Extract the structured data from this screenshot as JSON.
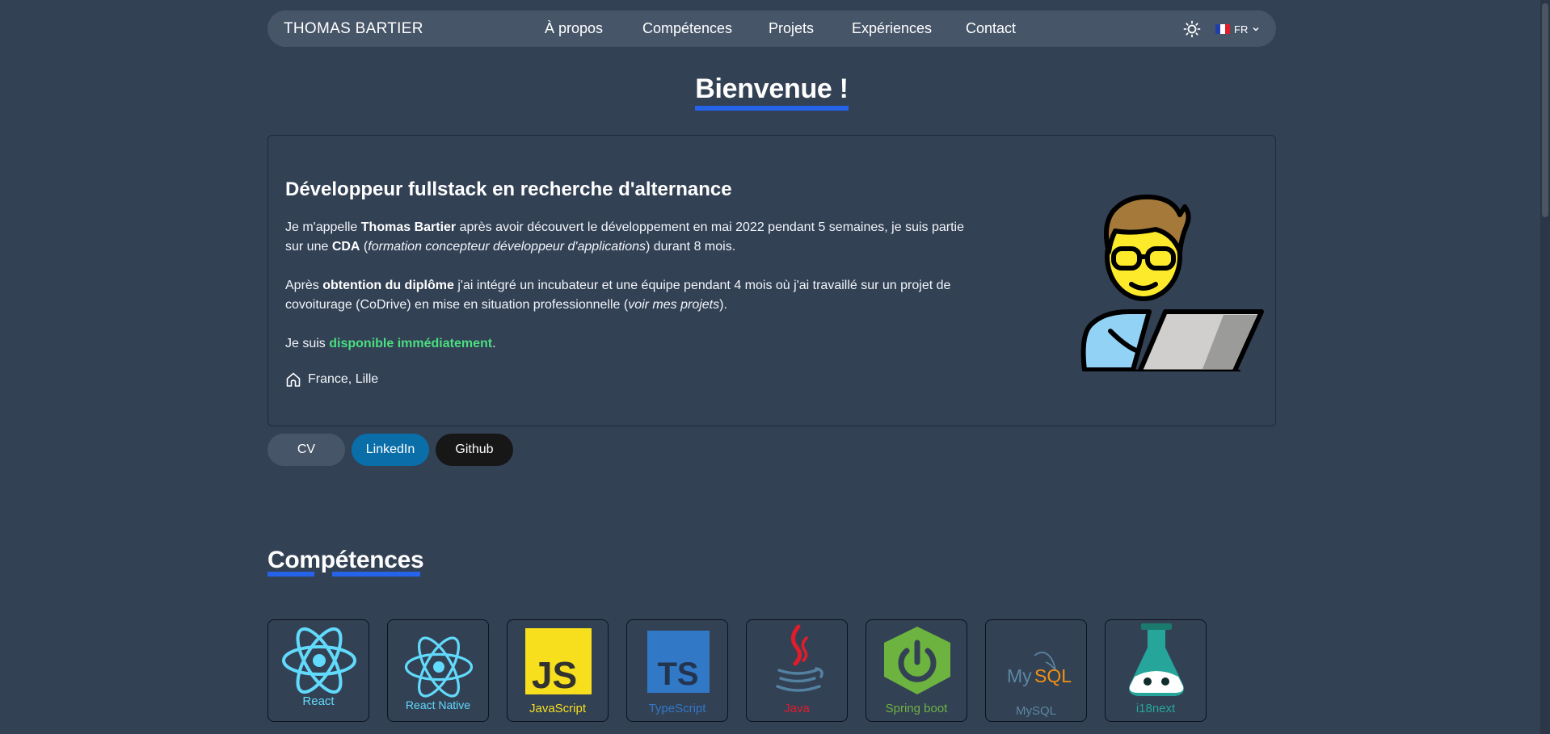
{
  "navbar": {
    "brand": "THOMAS BARTIER",
    "links": [
      {
        "label": "À propos"
      },
      {
        "label": "Compétences"
      },
      {
        "label": "Projets"
      },
      {
        "label": "Expériences"
      },
      {
        "label": "Contact"
      }
    ],
    "theme_icon": "sun-icon",
    "language": "FR",
    "flag_colors": [
      "#1f3fa8",
      "#ffffff",
      "#e11d2a"
    ]
  },
  "hero": {
    "heading": "Bienvenue !",
    "card_title": "Développeur fullstack en recherche d'alternance",
    "p1": {
      "a": "Je m'appelle ",
      "name": "Thomas Bartier",
      "b": " après avoir découvert le développement en mai 2022 pendant 5 semaines, je suis partie sur une ",
      "cda": "CDA",
      "c": " (",
      "cda_full": "formation concepteur développeur d'applications",
      "d": ") durant 8 mois."
    },
    "p2": {
      "a": "Après ",
      "diploma": "obtention du diplôme",
      "b": " j'ai intégré un incubateur et une équipe pendant 4 mois où j'ai travaillé sur un projet de covoiturage (CoDrive) en mise en situation professionnelle (",
      "projects": "voir mes projets",
      "c": ")."
    },
    "p3": {
      "a": "Je suis ",
      "available": "disponible immédiatement",
      "b": "."
    },
    "location": "France, Lille",
    "avatar_icon": "developer-avatar-icon"
  },
  "buttons": {
    "cv": "CV",
    "linkedin": "LinkedIn",
    "github": "Github"
  },
  "skills_section": {
    "heading": "Compétences",
    "items": [
      {
        "label": "React",
        "color": "#61dafb",
        "icon": "react-icon"
      },
      {
        "label": "React Native",
        "color": "#61dafb",
        "icon": "react-native-icon"
      },
      {
        "label": "JavaScript",
        "color": "#f7df1e",
        "icon": "javascript-icon"
      },
      {
        "label": "TypeScript",
        "color": "#3178c6",
        "icon": "typescript-icon"
      },
      {
        "label": "Java",
        "color": "#e11d2a",
        "icon": "java-icon"
      },
      {
        "label": "Spring boot",
        "color": "#6db33f",
        "icon": "spring-boot-icon"
      },
      {
        "label": "MySQL",
        "color": "#5d87a1",
        "icon": "mysql-icon"
      },
      {
        "label": "i18next",
        "color": "#26a69a",
        "icon": "i18next-icon"
      }
    ]
  }
}
